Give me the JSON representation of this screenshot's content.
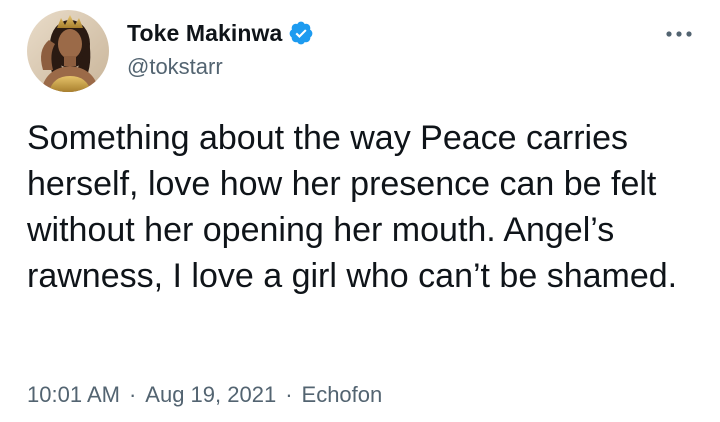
{
  "author": {
    "display_name": "Toke Makinwa",
    "handle": "@tokstarr",
    "verified": true
  },
  "menu": {
    "icon": "more-horizontal-icon"
  },
  "tweet": {
    "text": "Something about the way Peace carries herself, love how her presence can be felt without her opening her mouth. Angel’s rawness, I love a girl who can’t be shamed."
  },
  "meta": {
    "time": "10:01 AM",
    "separator": "·",
    "date": "Aug 19, 2021",
    "source": "Echofon"
  },
  "colors": {
    "text_primary": "#0f1419",
    "text_secondary": "#536471",
    "verified_blue": "#1d9bf0"
  }
}
